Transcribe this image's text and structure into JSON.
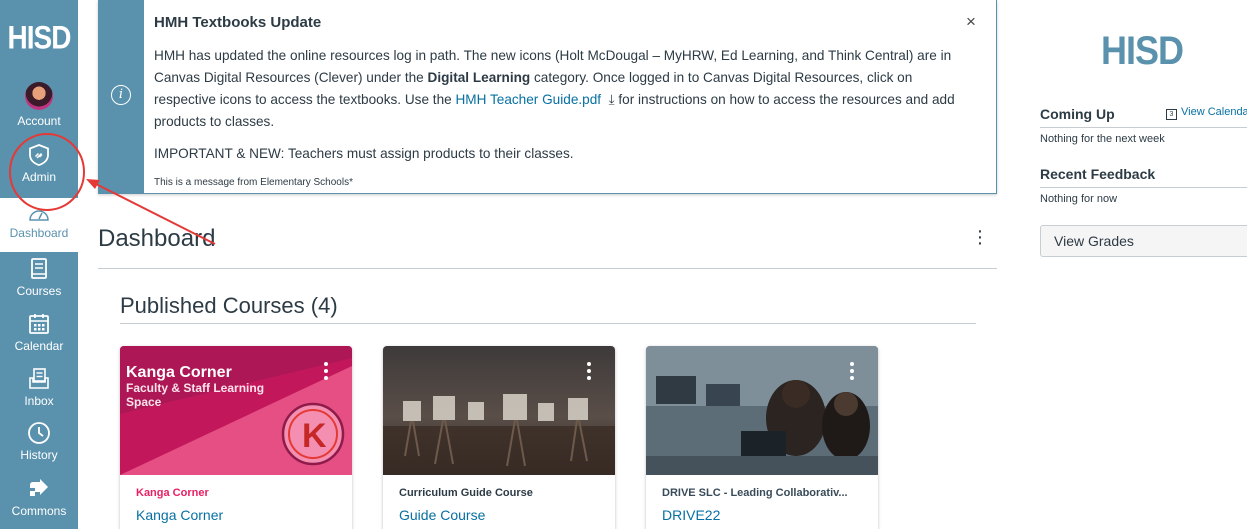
{
  "nav": {
    "logo": "HISD",
    "items": [
      {
        "label": "Account",
        "icon": "avatar-icon"
      },
      {
        "label": "Admin",
        "icon": "shield-icon"
      },
      {
        "label": "Dashboard",
        "icon": "dashboard-icon"
      },
      {
        "label": "Courses",
        "icon": "book-icon"
      },
      {
        "label": "Calendar",
        "icon": "calendar-icon"
      },
      {
        "label": "Inbox",
        "icon": "inbox-icon"
      },
      {
        "label": "History",
        "icon": "clock-icon"
      },
      {
        "label": "Commons",
        "icon": "commons-icon"
      }
    ]
  },
  "announcement": {
    "title": "HMH Textbooks Update",
    "close": "×",
    "body_part1": "HMH has updated the online resources log in path. The new icons (Holt McDougal – MyHRW, Ed Learning, and Think Central) are in Canvas Digital Resources (Clever) under the ",
    "body_bold": "Digital Learning",
    "body_part2": " category. Once logged in to Canvas Digital Resources, click on respective icons to access the textbooks. Use the ",
    "link_text": "HMH Teacher Guide.pdf",
    "body_part3": " for instructions on how to access the resources and add products to classes.",
    "important": "IMPORTANT & NEW: Teachers must assign products to their classes.",
    "from": "This is a message from Elementary Schools*"
  },
  "dashboard": {
    "title": "Dashboard",
    "section_title": "Published Courses (4)"
  },
  "courses": [
    {
      "subtitle": "Kanga Corner",
      "name": "Kanga Corner",
      "hero_title": "Kanga Corner",
      "hero_sub1": "Faculty & Staff Learning",
      "hero_sub2": "Space",
      "color": "#e91e63"
    },
    {
      "subtitle": "Curriculum Guide Course",
      "name": "Guide Course",
      "color": "#2d3b45"
    },
    {
      "subtitle": "DRIVE SLC - Leading Collaborativ...",
      "name": "DRIVE22",
      "color": "#394b58"
    }
  ],
  "sidebar": {
    "logo": "HISD",
    "coming_up": "Coming Up",
    "view_calendar": "View Calenda",
    "nothing_next_week": "Nothing for the next week",
    "recent_feedback": "Recent Feedback",
    "nothing_now": "Nothing for now",
    "view_grades": "View Grades"
  },
  "colors": {
    "brand": "#5a92ae",
    "link": "#0770a3",
    "annotation": "#e53935"
  }
}
